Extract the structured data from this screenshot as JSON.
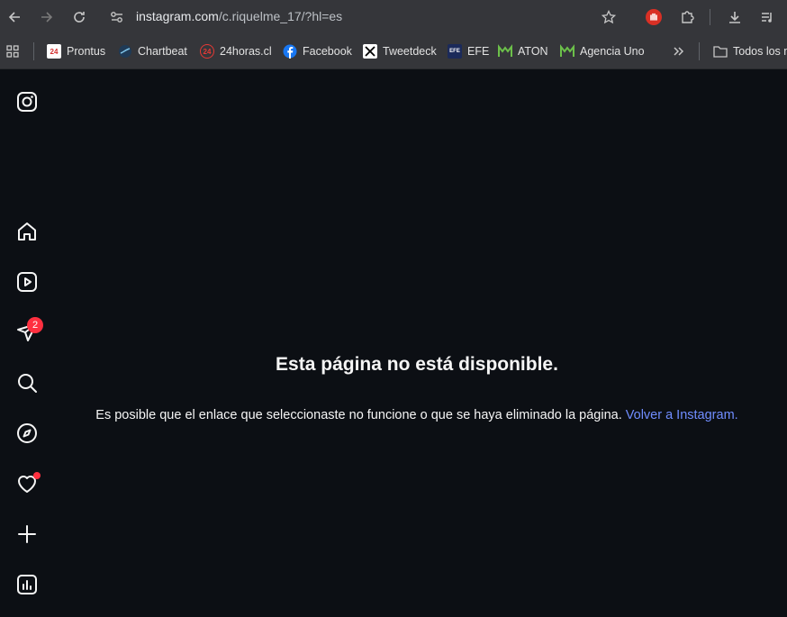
{
  "browser": {
    "url_host": "instagram.com",
    "url_rest": "/c.riquelme_17/?hl=es"
  },
  "bookmarks": [
    {
      "label": "Prontus",
      "icon": "24"
    },
    {
      "label": "Chartbeat",
      "icon": "chartbeat-icon"
    },
    {
      "label": "24horas.cl",
      "icon": "24"
    },
    {
      "label": "Facebook",
      "icon": "facebook-icon"
    },
    {
      "label": "Tweetdeck",
      "icon": "x-icon"
    },
    {
      "label": "EFE",
      "icon": "EFE"
    },
    {
      "label": "ATON",
      "icon": "aton-icon"
    },
    {
      "label": "Agencia Uno",
      "icon": "aton-icon"
    }
  ],
  "bookmarks_folder": "Todos los m",
  "sidebar": {
    "notification_count": "2"
  },
  "main": {
    "title": "Esta página no está disponible.",
    "message": "Es posible que el enlace que seleccionaste no funcione o que se haya eliminado la página. ",
    "link": "Volver a Instagram."
  },
  "colors": {
    "background": "#0c0f14",
    "link": "#708dff",
    "badge": "#ff3040"
  }
}
